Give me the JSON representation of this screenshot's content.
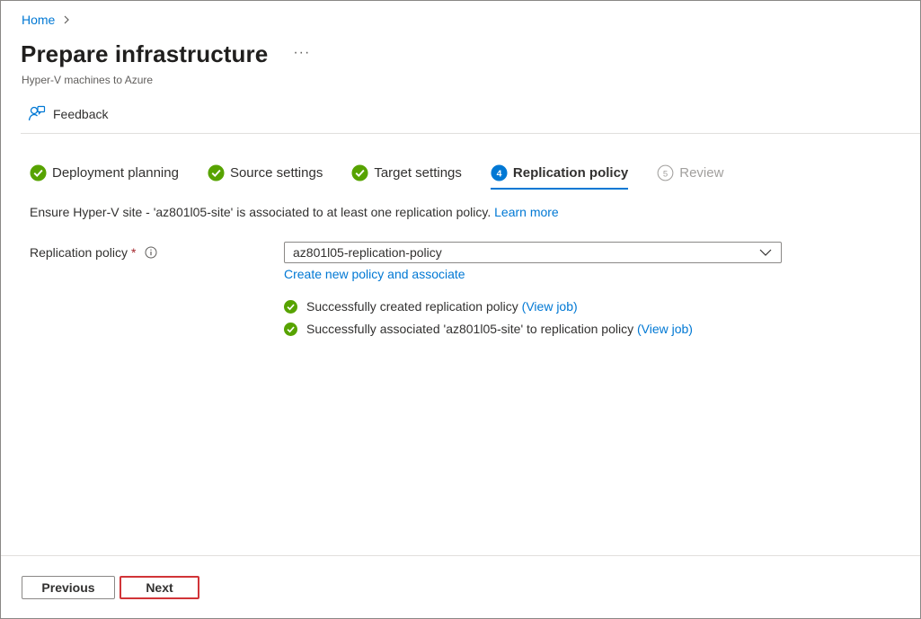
{
  "breadcrumb": {
    "home_label": "Home"
  },
  "header": {
    "title": "Prepare infrastructure",
    "more_label": "···",
    "subtitle": "Hyper-V machines to Azure"
  },
  "toolbar": {
    "feedback_label": "Feedback",
    "feedback_icon": "feedback-person-icon"
  },
  "steps": [
    {
      "label": "Deployment planning",
      "state": "completed"
    },
    {
      "label": "Source settings",
      "state": "completed"
    },
    {
      "label": "Target settings",
      "state": "completed"
    },
    {
      "label": "Replication policy",
      "number": "4",
      "state": "active"
    },
    {
      "label": "Review",
      "number": "5",
      "state": "disabled"
    }
  ],
  "info": {
    "text": "Ensure Hyper-V site - 'az801l05-site' is associated to at least one replication policy.",
    "learn_more": "Learn more"
  },
  "form": {
    "label": "Replication policy",
    "required_mark": "*",
    "selected_value": "az801l05-replication-policy",
    "create_link": "Create new policy and associate"
  },
  "messages": [
    {
      "text": "Successfully created replication policy",
      "link": "(View job)"
    },
    {
      "text": "Successfully associated 'az801l05-site' to replication policy",
      "link": "(View job)"
    }
  ],
  "footer": {
    "previous_label": "Previous",
    "next_label": "Next"
  },
  "colors": {
    "accent": "#0078d4",
    "success": "#57a300",
    "required": "#a4262c",
    "next_highlight": "#d13438"
  }
}
